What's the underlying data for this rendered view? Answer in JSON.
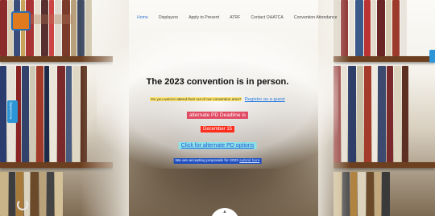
{
  "nav": {
    "items": [
      {
        "label": "Home",
        "active": true
      },
      {
        "label": "Displayers",
        "active": false
      },
      {
        "label": "Apply to Present",
        "active": false
      },
      {
        "label": "ATRF",
        "active": false
      },
      {
        "label": "Contact OHATCA",
        "active": false
      },
      {
        "label": "Convention Attendance",
        "active": false
      }
    ]
  },
  "side_tab": {
    "label": "Accessibility"
  },
  "main": {
    "headline": "The 2023 convention is in person.",
    "question": "Do you want to attend their out of our convention area?",
    "register_link": "Register as a guest",
    "pd_deadline": "alternate PD Deadline is",
    "pd_date": "December 15",
    "pd_link": "Click for alternate PD options",
    "accepting_text": "We are accepting proposals for 2023",
    "accepting_link": "submit here"
  },
  "colors": {
    "accent": "#3a7bd5",
    "highlight_yellow": "#ffe66b",
    "pink": "#e04a62",
    "red": "#ff2d1d",
    "teal": "#8fe1e8",
    "navy": "#1f4ec0",
    "side_tab": "#2b95d8"
  },
  "icons": {
    "logo": "organization-logo",
    "spinner": "loading-spinner-icon",
    "scroll": "chevron-up-icon"
  }
}
